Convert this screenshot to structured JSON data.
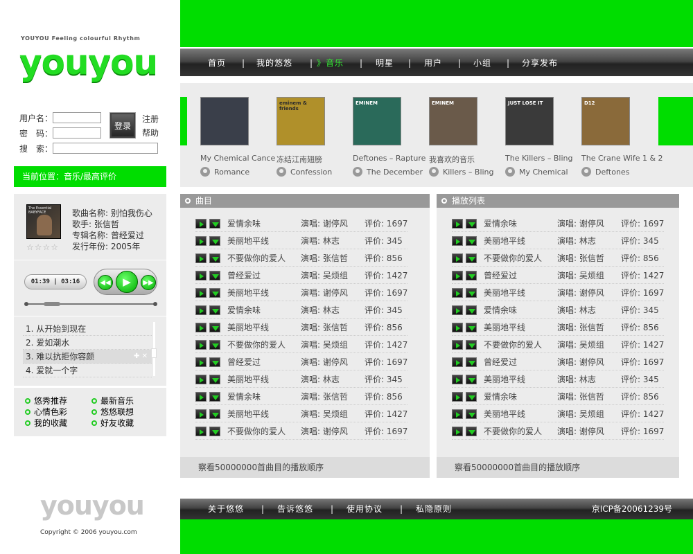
{
  "brand": {
    "tagline": "YOUYOU Feeling colourful Rhythm",
    "logo": "youyou",
    "footer_logo": "youyou",
    "copyright": "Copyright © 2006 youyou.com"
  },
  "login": {
    "username_label": "用户名：",
    "password_label": "密　码：",
    "search_label": "搜　索：",
    "login_button": "登录",
    "register": "注册",
    "help": "帮助"
  },
  "location": {
    "text": "当前位置：音乐/最高评价"
  },
  "song_info": {
    "cover_text": "The Essential BABYFACE",
    "name": "歌曲名称: 别怕我伤心",
    "singer": "歌手: 张信哲",
    "album": "专辑名称: 曾经爱过",
    "year": "发行年份: 2005年",
    "stars": "☆☆☆☆"
  },
  "player": {
    "time": "01:39 | 03:16",
    "progress": 0.2
  },
  "mini_playlist": [
    {
      "label": "1. 从开始到现在"
    },
    {
      "label": "2. 爱如潮水"
    },
    {
      "label": "3. 难以抗拒你容颜",
      "selected": true
    },
    {
      "label": "4. 爱就一个字"
    }
  ],
  "quick_links": [
    "悠秀推荐",
    "最新音乐",
    "心情色彩",
    "悠悠联想",
    "我的收藏",
    "好友收藏"
  ],
  "nav": {
    "items": [
      "首页",
      "我的悠悠",
      "》音乐",
      "明星",
      "用户",
      "小组",
      "分享发布"
    ],
    "separator": "|",
    "active_index": 2
  },
  "albums": [
    {
      "title": "My Chemical Cance",
      "artist": "Romance",
      "art_text": "",
      "bg": "#3a3f4a"
    },
    {
      "title": "冻结江南翅膀",
      "artist": "Confession",
      "art_text": "eminem & friends",
      "bg": "#b0902a"
    },
    {
      "title": "Deftones – Rapture",
      "artist": "The December",
      "art_text": "EMINEM",
      "bg": "#2a6a5a"
    },
    {
      "title": "我喜欢的音乐",
      "artist": "Killers – Bling",
      "art_text": "EMINEM",
      "bg": "#6a5a4a"
    },
    {
      "title": "The Killers – Bling",
      "artist": "My Chemical",
      "art_text": "JUST LOSE IT",
      "bg": "#3a3a3a"
    },
    {
      "title": "The Crane Wife 1 & 2",
      "artist": "Deftones",
      "art_text": "D12",
      "bg": "#8a6a3a"
    }
  ],
  "lists": [
    {
      "header": "曲目",
      "footer": "察看50000000首曲目的播放顺序",
      "rows": [
        [
          "爱情余味",
          "演唱: 谢停风",
          "评价: 1697"
        ],
        [
          "美丽地平线",
          "演唱: 林志",
          "评价: 345"
        ],
        [
          "不要做你的爱人",
          "演唱: 张信哲",
          "评价: 856"
        ],
        [
          "曾经爱过",
          "演唱: 吴烦组",
          "评价: 1427"
        ],
        [
          "美丽地平线",
          "演唱: 谢停风",
          "评价: 1697"
        ],
        [
          "爱情余味",
          "演唱: 林志",
          "评价: 345"
        ],
        [
          "美丽地平线",
          "演唱: 张信哲",
          "评价: 856"
        ],
        [
          "不要做你的爱人",
          "演唱: 吴烦组",
          "评价: 1427"
        ],
        [
          "曾经爱过",
          "演唱: 谢停风",
          "评价: 1697"
        ],
        [
          "美丽地平线",
          "演唱: 林志",
          "评价: 345"
        ],
        [
          "爱情余味",
          "演唱: 张信哲",
          "评价: 856"
        ],
        [
          "美丽地平线",
          "演唱: 吴烦组",
          "评价: 1427"
        ],
        [
          "不要做你的爱人",
          "演唱: 谢停风",
          "评价: 1697"
        ]
      ]
    },
    {
      "header": "播放列表",
      "footer": "察看50000000首曲目的播放顺序",
      "rows": [
        [
          "爱情余味",
          "演唱: 谢停风",
          "评价: 1697"
        ],
        [
          "美丽地平线",
          "演唱: 林志",
          "评价: 345"
        ],
        [
          "不要做你的爱人",
          "演唱: 张信哲",
          "评价: 856"
        ],
        [
          "曾经爱过",
          "演唱: 吴烦组",
          "评价: 1427"
        ],
        [
          "美丽地平线",
          "演唱: 谢停风",
          "评价: 1697"
        ],
        [
          "爱情余味",
          "演唱: 林志",
          "评价: 345"
        ],
        [
          "美丽地平线",
          "演唱: 张信哲",
          "评价: 856"
        ],
        [
          "不要做你的爱人",
          "演唱: 吴烦组",
          "评价: 1427"
        ],
        [
          "曾经爱过",
          "演唱: 谢停风",
          "评价: 1697"
        ],
        [
          "美丽地平线",
          "演唱: 林志",
          "评价: 345"
        ],
        [
          "爱情余味",
          "演唱: 张信哲",
          "评价: 856"
        ],
        [
          "美丽地平线",
          "演唱: 吴烦组",
          "评价: 1427"
        ],
        [
          "不要做你的爱人",
          "演唱: 谢停风",
          "评价: 1697"
        ]
      ]
    }
  ],
  "footer_nav": {
    "items": [
      "关于悠悠",
      "告诉悠悠",
      "使用协议",
      "私隐原则"
    ],
    "separator": "|",
    "icp": "京ICP备20061239号"
  },
  "colors": {
    "accent": "#00dd00",
    "dark_bar": "#333333",
    "panel": "#ececec"
  }
}
